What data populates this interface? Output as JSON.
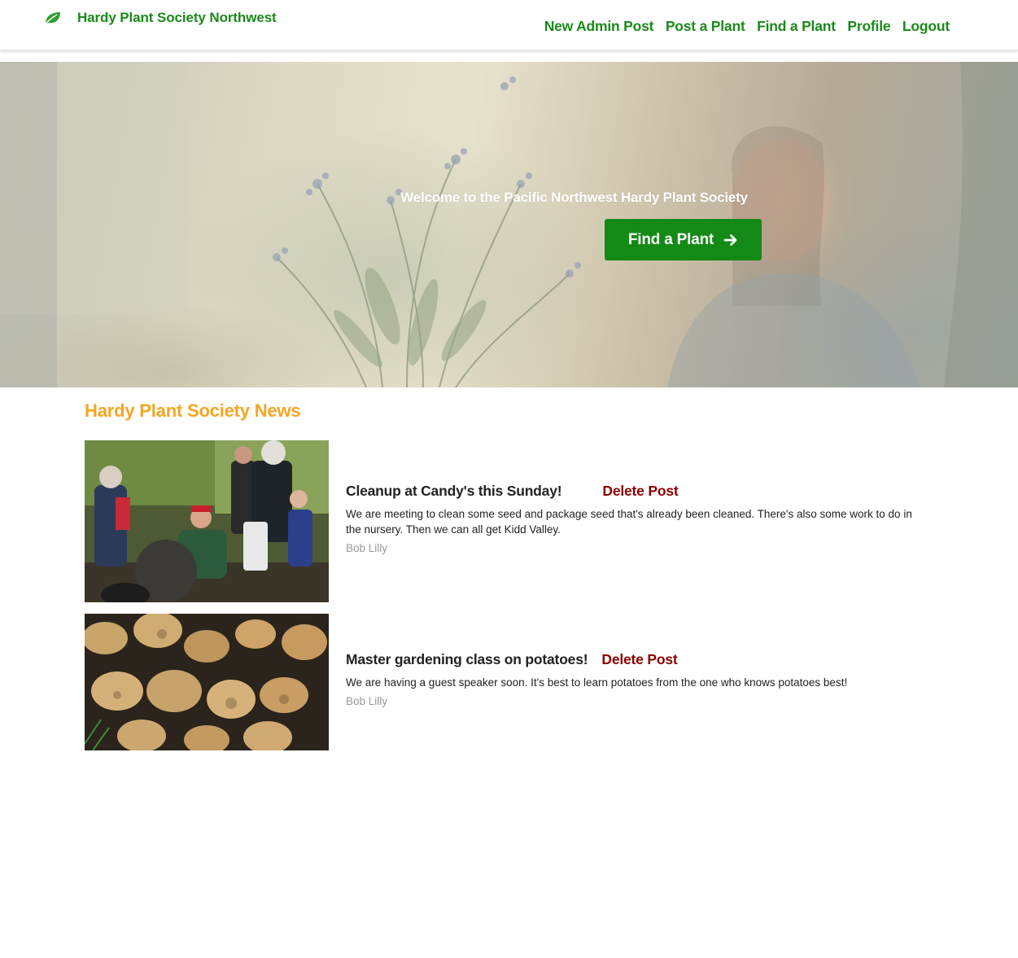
{
  "navbar": {
    "brand": "Hardy Plant Society Northwest",
    "links": [
      "New Admin Post",
      "Post a Plant",
      "Find a Plant",
      "Profile",
      "Logout"
    ]
  },
  "hero": {
    "title": "Welcome to the Pacific Northwest Hardy Plant Society",
    "button_label": "Find a Plant"
  },
  "news": {
    "heading": "Hardy Plant Society News",
    "posts": [
      {
        "title": "Cleanup at Candy's this Sunday!",
        "delete_label": "Delete Post",
        "body": "We are meeting to clean some seed and package seed that's already been cleaned. There's also some work to do in the nursery. Then we can all get Kidd Valley.",
        "author": "Bob Lilly"
      },
      {
        "title": "Master gardening class on potatoes!",
        "delete_label": "Delete Post",
        "body": "We are having a guest speaker soon. It's best to learn potatoes from the one who knows potatoes best!",
        "author": "Bob Lilly"
      }
    ]
  },
  "colors": {
    "brand_green": "#1a8a1a",
    "button_green": "#138a16",
    "news_orange": "#f5a623",
    "delete_red": "#8b0000"
  },
  "icons": {
    "brand": "leaf-icon",
    "hero_button": "arrow-right-icon"
  }
}
